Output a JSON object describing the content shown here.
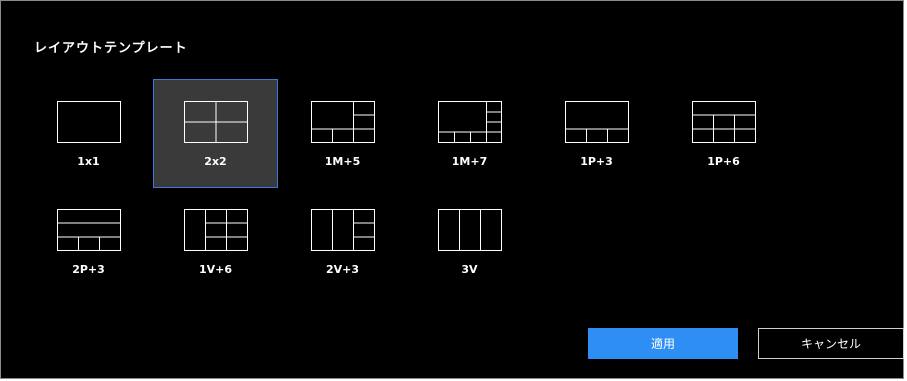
{
  "dialog": {
    "title": "レイアウトテンプレート",
    "selected": "2x2",
    "templates": [
      {
        "id": "1x1",
        "label": "1x1"
      },
      {
        "id": "2x2",
        "label": "2x2"
      },
      {
        "id": "1M+5",
        "label": "1M+5"
      },
      {
        "id": "1M+7",
        "label": "1M+7"
      },
      {
        "id": "1P+3",
        "label": "1P+3"
      },
      {
        "id": "1P+6",
        "label": "1P+6"
      },
      {
        "id": "2P+3",
        "label": "2P+3"
      },
      {
        "id": "1V+6",
        "label": "1V+6"
      },
      {
        "id": "2V+3",
        "label": "2V+3"
      },
      {
        "id": "3V",
        "label": "3V"
      }
    ],
    "apply_label": "適用",
    "cancel_label": "キャンセル"
  },
  "colors": {
    "background": "#000000",
    "selected_bg": "#3a3a3a",
    "selected_border": "#3c78d8",
    "apply_button": "#2f8ef4"
  }
}
